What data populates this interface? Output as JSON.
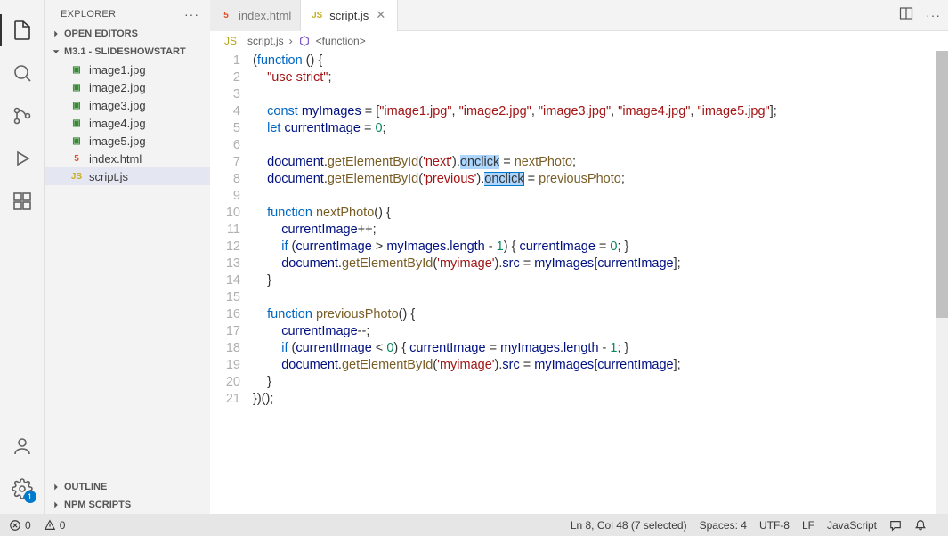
{
  "sidebar": {
    "title": "EXPLORER",
    "sections": {
      "openEditors": "OPEN EDITORS",
      "project": "M3.1 - SLIDESHOWSTART",
      "outline": "OUTLINE",
      "npm": "NPM SCRIPTS"
    },
    "files": [
      {
        "name": "image1.jpg",
        "icon": "img"
      },
      {
        "name": "image2.jpg",
        "icon": "img"
      },
      {
        "name": "image3.jpg",
        "icon": "img"
      },
      {
        "name": "image4.jpg",
        "icon": "img"
      },
      {
        "name": "image5.jpg",
        "icon": "img"
      },
      {
        "name": "index.html",
        "icon": "html"
      },
      {
        "name": "script.js",
        "icon": "js",
        "sel": true
      }
    ],
    "settingsBadge": "1"
  },
  "tabs": [
    {
      "name": "index.html",
      "icon": "html"
    },
    {
      "name": "script.js",
      "icon": "js",
      "active": true
    }
  ],
  "breadcrumb": {
    "file": "script.js",
    "symbol": "<function>"
  },
  "status": {
    "errors": "0",
    "warnings": "0",
    "cursor": "Ln 8, Col 48 (7 selected)",
    "spaces": "Spaces: 4",
    "enc": "UTF-8",
    "eol": "LF",
    "lang": "JavaScript"
  },
  "code": {
    "lines": 21,
    "l1": {
      "a": "(",
      "b": "function",
      "c": " () {"
    },
    "l2": {
      "a": "    ",
      "b": "\"use strict\"",
      "c": ";"
    },
    "l4": {
      "a": "    ",
      "b": "const",
      "c": " ",
      "d": "myImages",
      "e": " = [",
      "s1": "\"image1.jpg\"",
      "s2": "\"image2.jpg\"",
      "s3": "\"image3.jpg\"",
      "s4": "\"image4.jpg\"",
      "s5": "\"image5.jpg\"",
      "f": "];"
    },
    "l5": {
      "a": "    ",
      "b": "let",
      "c": " ",
      "d": "currentImage",
      "e": " = ",
      "f": "0",
      "g": ";"
    },
    "l7": {
      "a": "    ",
      "b": "document",
      "c": ".",
      "d": "getElementById",
      "e": "(",
      "f": "'next'",
      "g": ").",
      "h": "onclick",
      "i": " = ",
      "j": "nextPhoto",
      "k": ";"
    },
    "l8": {
      "a": "    ",
      "b": "document",
      "c": ".",
      "d": "getElementById",
      "e": "(",
      "f": "'previous'",
      "g": ").",
      "h": "onclick",
      "i": " = ",
      "j": "previousPhoto",
      "k": ";"
    },
    "l10": {
      "a": "    ",
      "b": "function",
      "c": " ",
      "d": "nextPhoto",
      "e": "() {"
    },
    "l11": {
      "a": "        ",
      "b": "currentImage",
      "c": "++;"
    },
    "l12": {
      "a": "        ",
      "b": "if",
      "c": " (",
      "d": "currentImage",
      "e": " > ",
      "f": "myImages",
      "g": ".",
      "h": "length",
      "i": " - ",
      "j": "1",
      "k": ") { ",
      "l": "currentImage",
      "m": " = ",
      "n": "0",
      "o": "; }"
    },
    "l13": {
      "a": "        ",
      "b": "document",
      "c": ".",
      "d": "getElementById",
      "e": "(",
      "f": "'myimage'",
      "g": ").",
      "h": "src",
      "i": " = ",
      "j": "myImages",
      "k": "[",
      "l": "currentImage",
      "m": "];"
    },
    "l14": {
      "a": "    }"
    },
    "l16": {
      "a": "    ",
      "b": "function",
      "c": " ",
      "d": "previousPhoto",
      "e": "() {"
    },
    "l17": {
      "a": "        ",
      "b": "currentImage",
      "c": "--;"
    },
    "l18": {
      "a": "        ",
      "b": "if",
      "c": " (",
      "d": "currentImage",
      "e": " < ",
      "f": "0",
      "g": ") { ",
      "h": "currentImage",
      "i": " = ",
      "j": "myImages",
      "k": ".",
      "l": "length",
      "m": " - ",
      "n": "1",
      "o": "; }"
    },
    "l19": {
      "a": "        ",
      "b": "document",
      "c": ".",
      "d": "getElementById",
      "e": "(",
      "f": "'myimage'",
      "g": ").",
      "h": "src",
      "i": " = ",
      "j": "myImages",
      "k": "[",
      "l": "currentImage",
      "m": "];"
    },
    "l20": {
      "a": "    }"
    },
    "l21": {
      "a": "})();"
    }
  }
}
